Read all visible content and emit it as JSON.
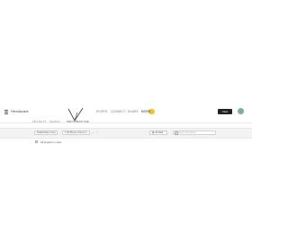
{
  "app": {
    "title": "Heedscale"
  },
  "logo": {
    "text": "SKETCHBOOK ONE"
  },
  "nav": {
    "items": [
      {
        "label": "SHOPS"
      },
      {
        "label": "CONNECT"
      },
      {
        "label": "SHARE"
      },
      {
        "label": "MORE"
      }
    ]
  },
  "header": {
    "view_button": "View"
  },
  "subnav": {
    "items": [
      {
        "label": "PROJECTS"
      },
      {
        "label": "SEARCH"
      }
    ]
  },
  "filters": {
    "first": "Stakeholders View",
    "second": "1 Fill Places chosen p",
    "all_filter": "All Data",
    "search_placeholder": "Search something..."
  },
  "list": {
    "label": "All projects in view"
  },
  "colors": {
    "badge": "#f2c230",
    "avatar": "#7bb28f",
    "view_button": "#222222"
  },
  "icons": [
    "menu-icon",
    "logo-mark-icon",
    "chevron-down-icon",
    "close-icon",
    "filter-icon",
    "search-icon",
    "avatar-icon"
  ]
}
